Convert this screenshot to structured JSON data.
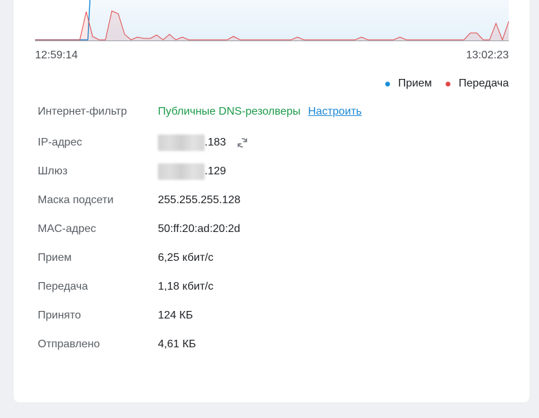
{
  "colors": {
    "rx": "#1a8fd8",
    "tx": "#e04848"
  },
  "chart": {
    "time_start": "12:59:14",
    "time_end": "13:02:23"
  },
  "legend": {
    "rx_label": "Прием",
    "tx_label": "Передача"
  },
  "chart_data": {
    "type": "area",
    "x_labels": [
      "12:59:14",
      "13:02:23"
    ],
    "series": [
      {
        "name": "Прием",
        "color": "#1a8fd8",
        "values": [
          0,
          0,
          0,
          0,
          0,
          0,
          0,
          0,
          0,
          0,
          0,
          0,
          0,
          0,
          0,
          0,
          0,
          0,
          0,
          0,
          0,
          0,
          0,
          0,
          0,
          0,
          0,
          0,
          0,
          0,
          0,
          0,
          0,
          0,
          0,
          0,
          0,
          0,
          0,
          0,
          0,
          0,
          0,
          0,
          0,
          0,
          0,
          0,
          0,
          0,
          0,
          0,
          0,
          0,
          0,
          0,
          0,
          0,
          0,
          0,
          0,
          0,
          0,
          0,
          0,
          0,
          0,
          0,
          0,
          0,
          0,
          0,
          0,
          0
        ]
      },
      {
        "name": "Передача",
        "color": "#e04848",
        "values": [
          0,
          0,
          0,
          0,
          0,
          0,
          0,
          0,
          41,
          5,
          0,
          0,
          42,
          38,
          8,
          0,
          4,
          2,
          2,
          7,
          0,
          8,
          0,
          4,
          0,
          0,
          0,
          0,
          0,
          0,
          0,
          5,
          0,
          0,
          0,
          0,
          0,
          0,
          0,
          0,
          0,
          4,
          0,
          0,
          0,
          0,
          0,
          0,
          0,
          0,
          0,
          4,
          0,
          0,
          0,
          0,
          0,
          4,
          0,
          0,
          0,
          0,
          0,
          0,
          0,
          0,
          0,
          0,
          10,
          10,
          0,
          0,
          24,
          0,
          27
        ]
      }
    ]
  },
  "rows": {
    "filter": {
      "label": "Интернет-фильтр",
      "value": "Публичные DNS-резолверы",
      "link": "Настроить"
    },
    "ip": {
      "label": "IP-адрес",
      "value_suffix": ".183"
    },
    "gateway": {
      "label": "Шлюз",
      "value_suffix": ".129"
    },
    "mask": {
      "label": "Маска подсети",
      "value": "255.255.255.128"
    },
    "mac": {
      "label": "MAC-адрес",
      "value": "50:ff:20:ad:20:2d"
    },
    "rx_rate": {
      "label": "Прием",
      "value": "6,25 кбит/с"
    },
    "tx_rate": {
      "label": "Передача",
      "value": "1,18 кбит/с"
    },
    "received": {
      "label": "Принято",
      "value": "124 КБ"
    },
    "sent": {
      "label": "Отправлено",
      "value": "4,61 КБ"
    }
  }
}
